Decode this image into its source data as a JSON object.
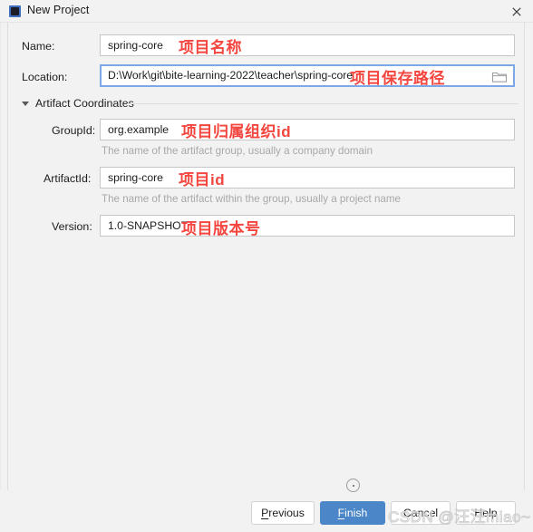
{
  "window": {
    "title": "New Project",
    "icon": "intellij-idea-icon",
    "close_label": "×"
  },
  "form": {
    "name": {
      "label": "Name:",
      "value": "spring-core",
      "annotation": "项目名称"
    },
    "location": {
      "label": "Location:",
      "value": "D:\\Work\\git\\bite-learning-2022\\teacher\\spring-core",
      "annotation": "项目保存路径",
      "browse_icon": "folder-icon",
      "focused": true
    }
  },
  "artifact_section": {
    "title": "Artifact Coordinates",
    "expanded": true,
    "fields": [
      {
        "label": "GroupId:",
        "value": "org.example",
        "annotation": "项目归属组织id",
        "hint": "The name of the artifact group, usually a company domain"
      },
      {
        "label": "ArtifactId:",
        "value": "spring-core",
        "annotation": "项目id",
        "hint": "The name of the artifact within the group, usually a project name"
      },
      {
        "label": "Version:",
        "value": "1.0-SNAPSHOT",
        "annotation": "项目版本号",
        "hint": ""
      }
    ]
  },
  "footer": {
    "help_icon": "help-dot-circle-icon",
    "buttons": {
      "previous": "Previous",
      "previous_mnemonic": "P",
      "previous_rest": "revious",
      "finish": "Finish",
      "finish_mnemonic": "F",
      "finish_rest": "inish",
      "cancel": "Cancel",
      "help": "Help"
    }
  },
  "watermark": {
    "text": "CSDN @汪汪miao~"
  },
  "colors": {
    "accent": "#4a86c8",
    "annotation_red": "#f4463f",
    "focus_border": "#7aa8e8",
    "background": "#f2f2f2"
  }
}
